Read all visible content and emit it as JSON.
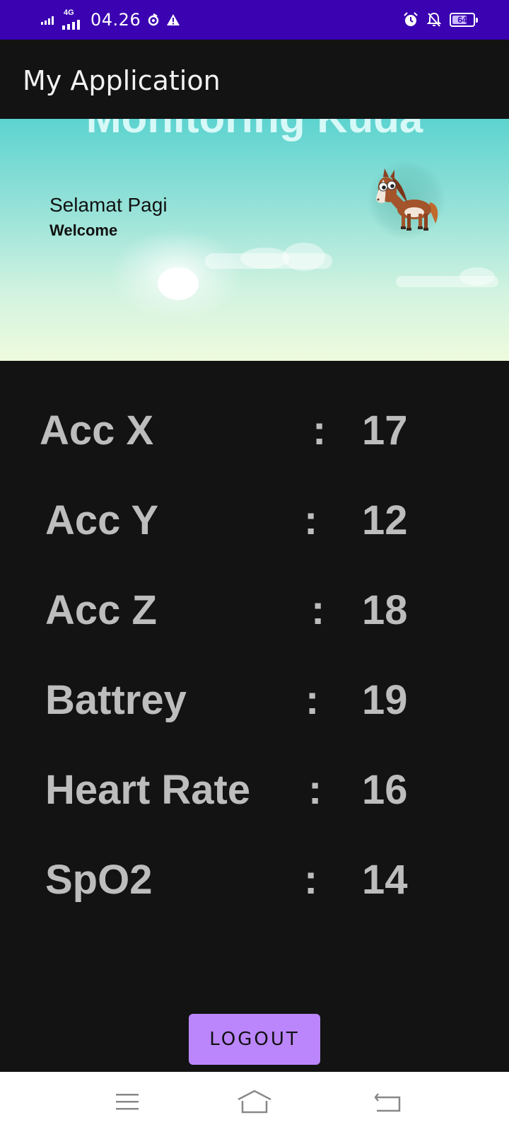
{
  "status_bar": {
    "network": "4G",
    "time": "04.26",
    "battery_level": "64"
  },
  "app_bar": {
    "title": "My Application"
  },
  "header": {
    "title": "Monitoring Kuda",
    "greeting": "Selamat Pagi",
    "welcome": "Welcome"
  },
  "readings": [
    {
      "label": "Acc X",
      "value": "17"
    },
    {
      "label": "Acc Y",
      "value": "12"
    },
    {
      "label": "Acc Z",
      "value": "18"
    },
    {
      "label": "Battrey",
      "value": "19"
    },
    {
      "label": "Heart Rate",
      "value": "16"
    },
    {
      "label": "SpO2",
      "value": "14"
    }
  ],
  "separator": ":",
  "logout_label": "LOGOUT",
  "nav": {
    "icons": [
      "menu-icon",
      "home-icon",
      "back-icon"
    ]
  },
  "colors": {
    "status_bar": "#3a02b1",
    "background": "#131313",
    "accent": "#bb86fc",
    "reading_text": "#bdbdbd"
  }
}
